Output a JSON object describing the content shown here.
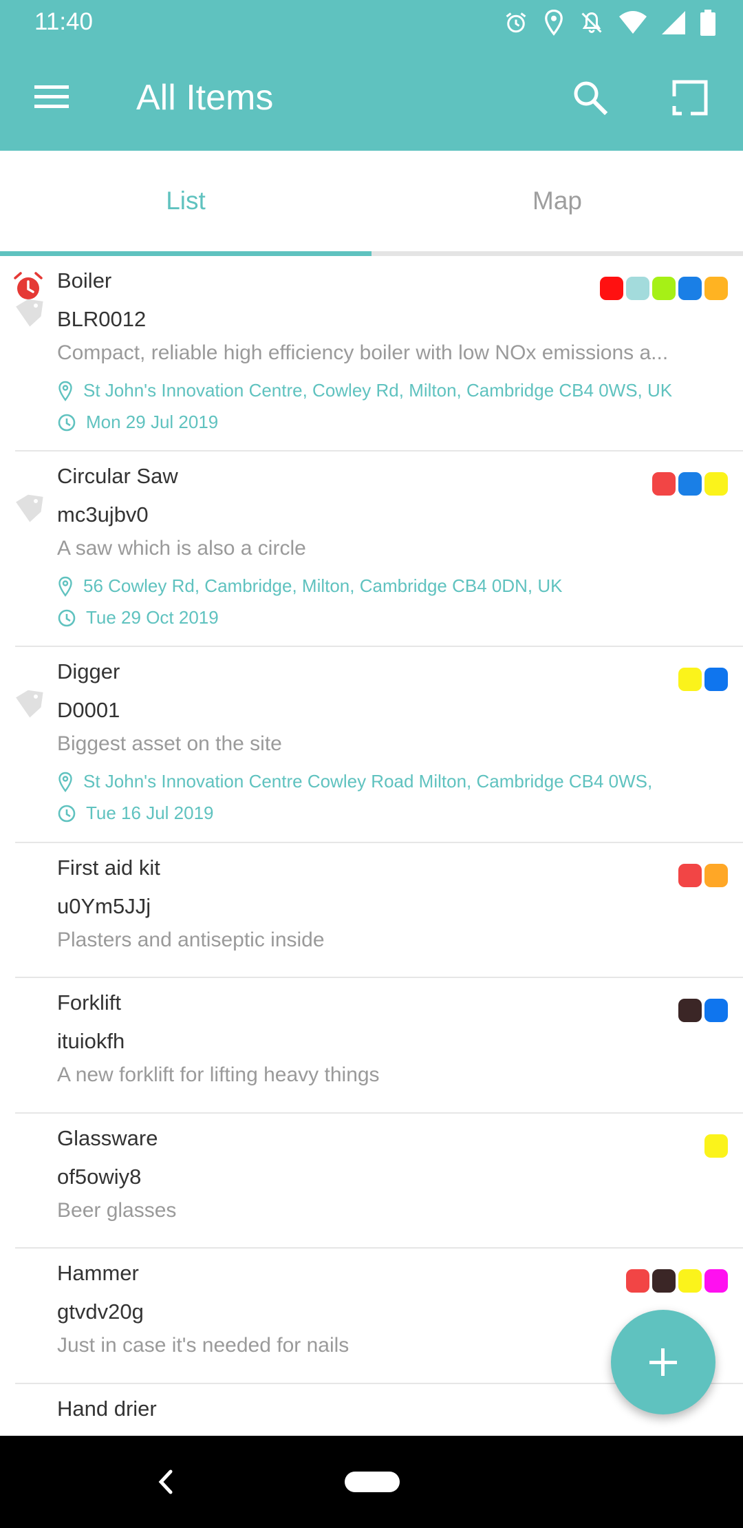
{
  "status_bar": {
    "time": "11:40",
    "icons": [
      "alarm-icon",
      "location-icon",
      "notifications-off-icon",
      "wifi-icon",
      "signal-icon",
      "battery-icon"
    ]
  },
  "toolbar": {
    "title": "All Items",
    "menu_icon": "menu-icon",
    "search_icon": "search-icon",
    "scan_icon": "scan-icon",
    "background_color": "#5fc2bf"
  },
  "tabs": [
    {
      "label": "List",
      "selected": true
    },
    {
      "label": "Map",
      "selected": false
    }
  ],
  "items": [
    {
      "name": "Boiler",
      "code": "BLR0012",
      "description": "Compact, reliable high efficiency boiler with low NOx emissions a...",
      "location": "St John's Innovation Centre, Cowley Rd, Milton, Cambridge CB4 0WS, UK",
      "date": "Mon 29 Jul 2019",
      "alarm": true,
      "tag_icon": true,
      "tags": [
        "#ff1111",
        "#a3dbdc",
        "#a6f016",
        "#1a7fe6",
        "#ffb322"
      ]
    },
    {
      "name": "Circular Saw",
      "code": "mc3ujbv0",
      "description": "A saw which is also a circle",
      "location": "56 Cowley Rd, Cambridge, Milton, Cambridge CB4 0DN, UK",
      "date": "Tue 29 Oct 2019",
      "alarm": false,
      "tag_icon": true,
      "tags": [
        "#f24545",
        "#1a7fe6",
        "#fbf31b"
      ]
    },
    {
      "name": "Digger",
      "code": "D0001",
      "description": "Biggest asset on the site",
      "location": "St John's Innovation Centre Cowley Road Milton, Cambridge CB4 0WS,",
      "date": "Tue 16 Jul 2019",
      "alarm": false,
      "tag_icon": true,
      "tags": [
        "#fbf31b",
        "#0f75ee"
      ]
    },
    {
      "name": "First aid kit",
      "code": "u0Ym5JJj",
      "description": "Plasters and antiseptic inside",
      "location": "",
      "date": "",
      "alarm": false,
      "tag_icon": false,
      "tags": [
        "#f24545",
        "#ffa726"
      ]
    },
    {
      "name": "Forklift",
      "code": "ituiokfh",
      "description": "A new forklift for lifting heavy things",
      "location": "",
      "date": "",
      "alarm": false,
      "tag_icon": false,
      "tags": [
        "#3b2626",
        "#0f75ee"
      ]
    },
    {
      "name": "Glassware",
      "code": "of5owiy8",
      "description": "Beer glasses",
      "location": "",
      "date": "",
      "alarm": false,
      "tag_icon": false,
      "tags": [
        "#fbf31b"
      ]
    },
    {
      "name": "Hammer",
      "code": "gtvdv20g",
      "description": "Just in case it's needed for nails",
      "location": "",
      "date": "",
      "alarm": false,
      "tag_icon": false,
      "tags": [
        "#f24545",
        "#3b2626",
        "#fbf31b",
        "#ff10f0"
      ]
    },
    {
      "name": "Hand drier",
      "code": "",
      "description": "",
      "location": "",
      "date": "",
      "alarm": false,
      "tag_icon": false,
      "tags": []
    }
  ],
  "fab": {
    "icon": "plus-icon"
  },
  "nav_bar": {
    "back_icon": "back-icon",
    "home_icon": "home-pill-icon"
  }
}
